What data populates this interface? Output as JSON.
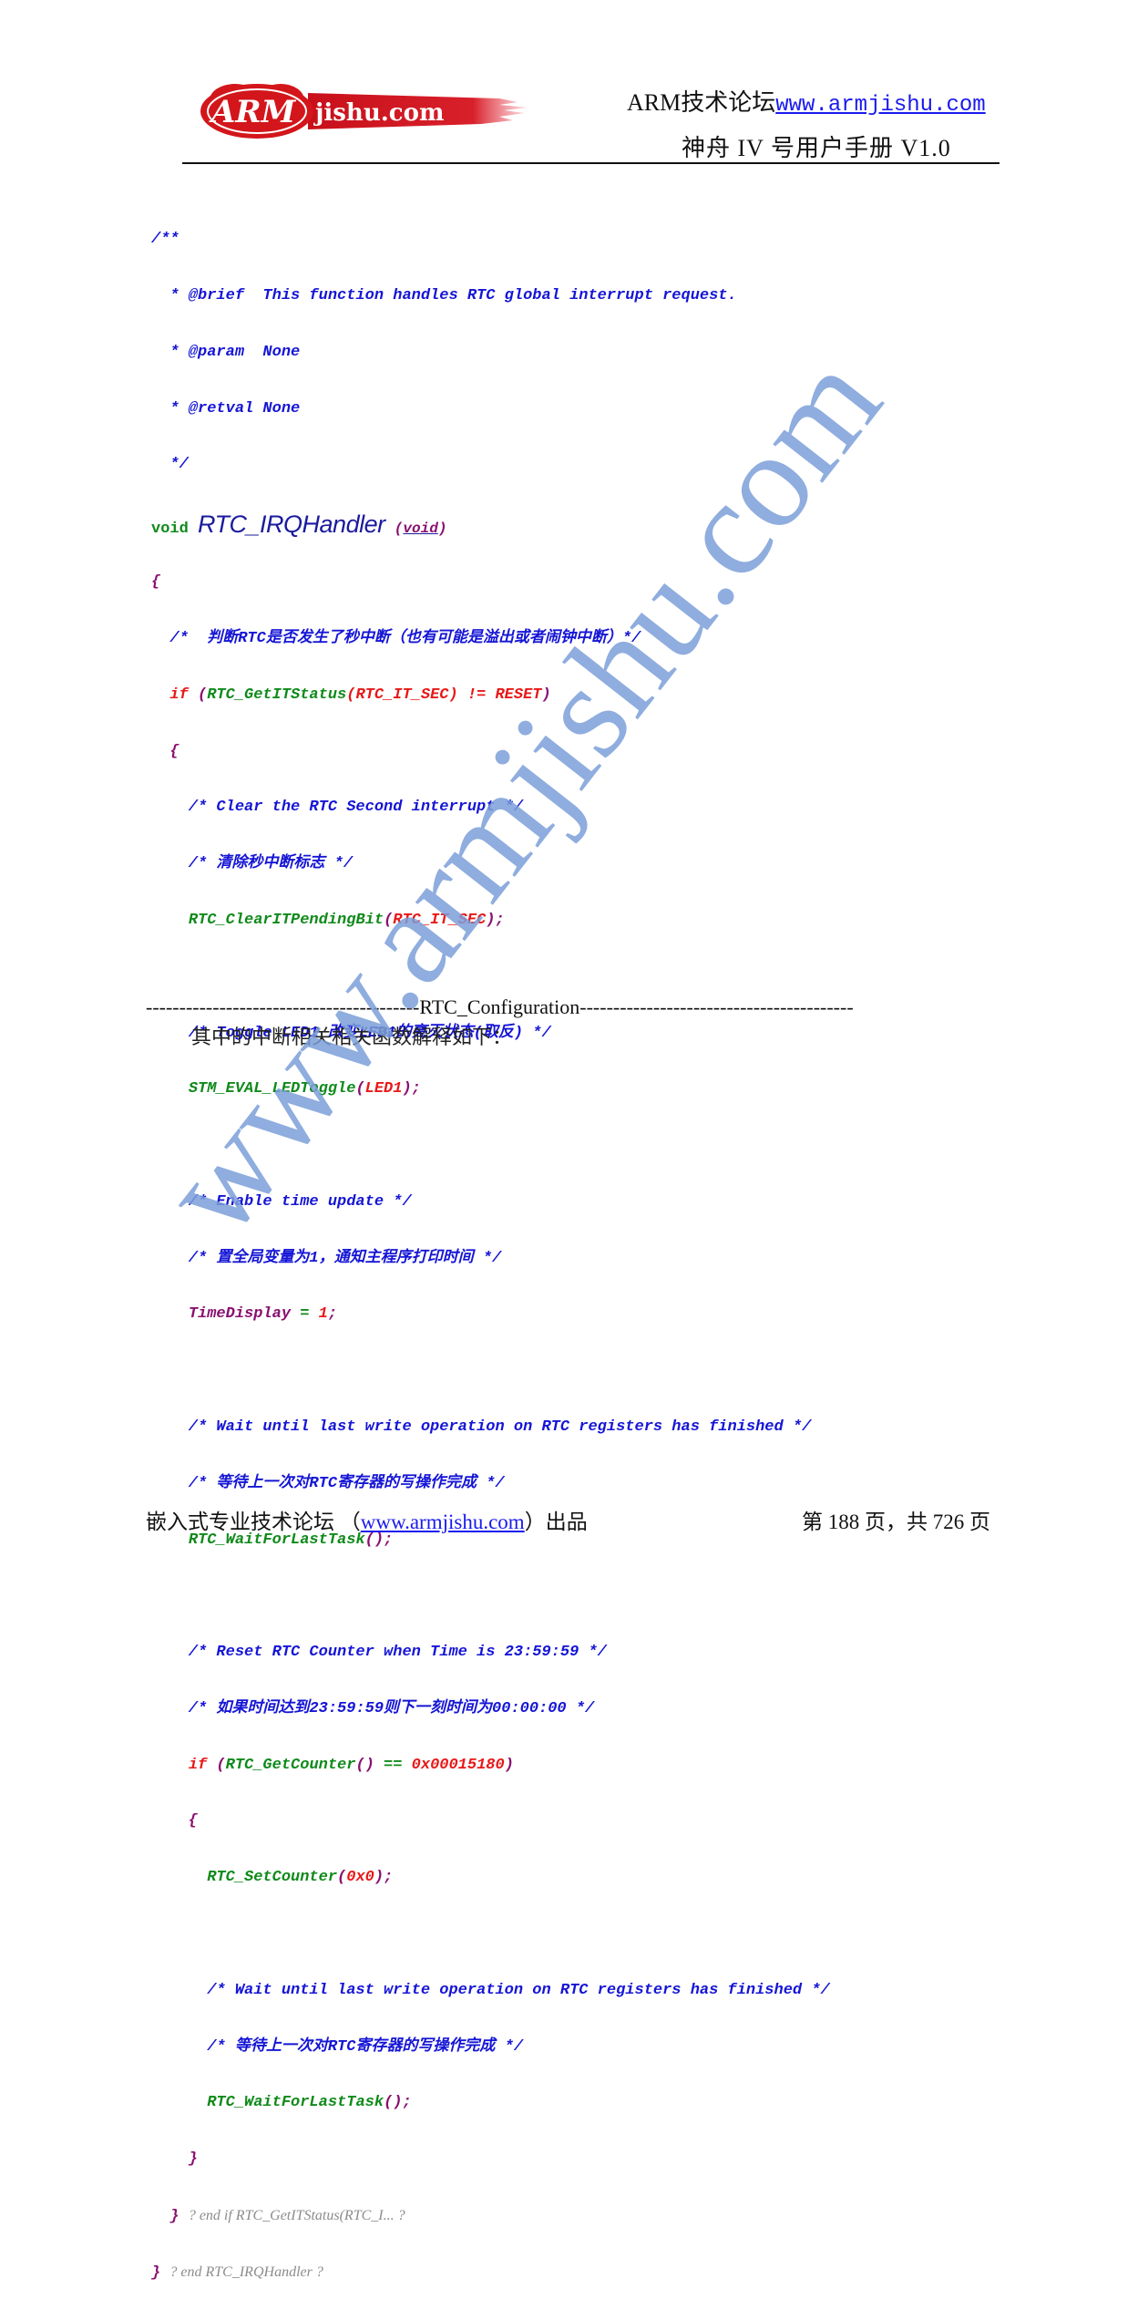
{
  "header": {
    "logo_text_main": "ARM",
    "logo_text_sub": "jishu.com",
    "forum_label": "ARM技术论坛",
    "forum_url": "www.armjishu.com",
    "manual_title": "神舟 IV 号用户手册 V1.0"
  },
  "code": {
    "doc_open": "/**",
    "doc_brief": "  * @brief  This function handles RTC global interrupt request.",
    "doc_param": "  * @param  None",
    "doc_retval": "  * @retval None",
    "doc_close": "  */",
    "sig_type": "void",
    "sig_name": "RTC_IRQHandler",
    "sig_params": "void",
    "open_brace": "{",
    "c1": "  /*  判断RTC是否发生了秒中断（也有可能是溢出或者闹钟中断）*/",
    "if1_kw": "if",
    "if1_open": " (",
    "if1_fn": "RTC_GetITStatus",
    "if1_arg": "(RTC_IT_SEC)",
    "if1_op": " != ",
    "if1_val": "RESET",
    "if1_close": ")",
    "brace2": "  {",
    "c2": "    /* Clear the RTC Second interrupt */",
    "c3": "    /* 清除秒中断标志 */",
    "s1_fn": "RTC_ClearITPendingBit",
    "s1_arg": "RTC_IT_SEC",
    "c4": "    /* Toggle LED1 改变LED1的亮灭状态(取反) */",
    "s2_fn": "STM_EVAL_LEDToggle",
    "s2_arg": "LED1",
    "c5": "    /* Enable time update */",
    "c6": "    /* 置全局变量为1，通知主程序打印时间 */",
    "s3_var": "TimeDisplay",
    "s3_op": " = ",
    "s3_val": "1",
    "c7": "    /* Wait until last write operation on RTC registers has finished */",
    "c8": "    /* 等待上一次对RTC寄存器的写操作完成 */",
    "s4_fn": "RTC_WaitForLastTask",
    "c9": "    /* Reset RTC Counter when Time is 23:59:59 */",
    "c10": "    /* 如果时间达到23:59:59则下一刻时间为00:00:00 */",
    "if2_kw": "if",
    "if2_fn": "RTC_GetCounter",
    "if2_op": " == ",
    "if2_val": "0x00015180",
    "brace3": "    {",
    "s5_fn": "RTC_SetCounter",
    "s5_arg": "0x0",
    "c11": "      /* Wait until last write operation on RTC registers has finished */",
    "c12": "      /* 等待上一次对RTC寄存器的写操作完成 */",
    "s6_fn": "RTC_WaitForLastTask",
    "close3": "    }",
    "end_if": "? end if RTC_GetITStatus(RTC_I... ?",
    "end_fn": "? end RTC_IRQHandler ?"
  },
  "section": {
    "divider_left": "-----------------------------------------",
    "divider_title": "RTC_Configuration",
    "divider_right": "-----------------------------------------",
    "paragraph": "其中的中断相关相关函数解释如下："
  },
  "footer": {
    "left_prefix": "嵌入式专业技术论坛 （",
    "left_link": "www.armjishu.com",
    "left_suffix": "）出品",
    "page_info": "第 188 页，共 726 页"
  },
  "watermark": {
    "text": "www.armjishu.com",
    "color": "#7b9fd8"
  },
  "colors": {
    "comment": "#1515d6",
    "keyword": "#e81818",
    "function": "#0f8a1a",
    "punctuation": "#8a1070",
    "logo_red": "#d3161b"
  }
}
